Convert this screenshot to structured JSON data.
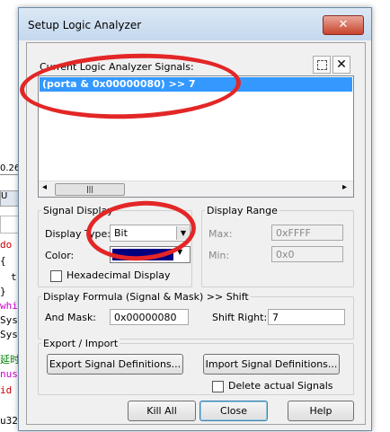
{
  "background": {
    "coordinate": "0.26",
    "lines": [
      {
        "text": "do",
        "color": "#cc0000"
      },
      {
        "text": "{",
        "color": "#000000"
      },
      {
        "text": "t",
        "color": "#000000"
      },
      {
        "text": "}",
        "color": "#000000"
      },
      {
        "text": "whi",
        "color": "#cc00cc"
      },
      {
        "text": "Sys",
        "color": "#000000"
      },
      {
        "text": "Sys",
        "color": "#000000"
      },
      {
        "text": "延时",
        "color": "#008000"
      },
      {
        "text": "nus",
        "color": "#cc00cc"
      },
      {
        "text": "id",
        "color": "#cc0000"
      },
      {
        "text": "u32",
        "color": "#000000"
      }
    ],
    "tab_label": "U"
  },
  "dialog": {
    "title": "Setup Logic Analyzer",
    "close_label": "✕",
    "signals": {
      "label": "Current Logic Analyzer Signals:",
      "items": [
        "(porta & 0x00000080) >> 7"
      ],
      "scroll_left": "◂",
      "scroll_right": "▸",
      "scroll_grip": "|||"
    },
    "signal_display": {
      "legend": "Signal Display",
      "display_type_label": "Display Type:",
      "display_type_value": "Bit",
      "color_label": "Color:",
      "color_value": "#00007f",
      "hex_label": "Hexadecimal Display",
      "hex_checked": false
    },
    "display_range": {
      "legend": "Display Range",
      "max_label": "Max:",
      "max_value": "0xFFFF",
      "min_label": "Min:",
      "min_value": "0x0"
    },
    "formula": {
      "legend": "Display Formula (Signal & Mask) >> Shift",
      "and_mask_label": "And Mask:",
      "and_mask_value": "0x00000080",
      "shift_right_label": "Shift Right:",
      "shift_right_value": "7"
    },
    "export_import": {
      "legend": "Export / Import",
      "export_button": "Export Signal Definitions...",
      "import_button": "Import Signal Definitions...",
      "delete_label": "Delete actual Signals",
      "delete_checked": false
    },
    "buttons": {
      "kill_all": "Kill All",
      "close": "Close",
      "help": "Help"
    }
  },
  "colors": {
    "selection": "#3399ff",
    "annotation": "#e32626"
  }
}
